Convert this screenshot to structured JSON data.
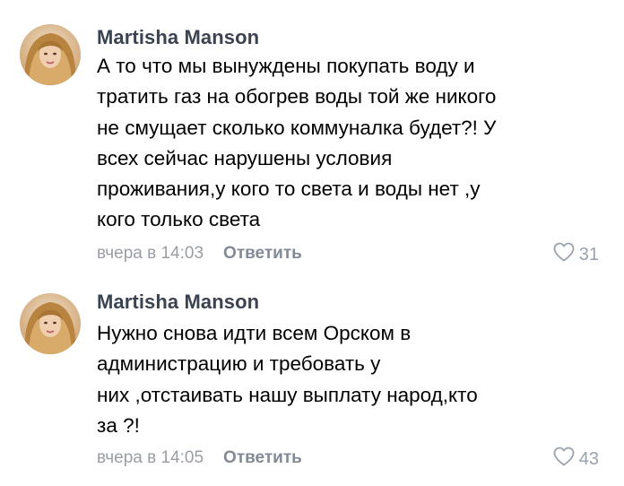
{
  "comments": [
    {
      "author": "Martisha Manson",
      "lines": [
        "А то что мы вынуждены покупать воду и",
        "тратить газ на обогрев воды той же никого",
        "не смущает сколько коммуналка будет?! У",
        "всех сейчас нарушены условия",
        "проживания,у кого то света и воды нет ,у",
        "кого только света"
      ],
      "time": "вчера в 14:03",
      "reply_label": "Ответить",
      "likes": "31"
    },
    {
      "author": "Martisha Manson",
      "lines": [
        "Нужно снова идти всем Орском в",
        "администрацию и требовать у",
        "них ,отстаивать нашу выплату народ,кто",
        "за ?!"
      ],
      "time": "вчера в 14:05",
      "reply_label": "Ответить",
      "likes": "43"
    }
  ],
  "colors": {
    "author": "#3b4351",
    "meta": "#9a9ea4",
    "reply": "#828a96",
    "like_icon": "#99a2ad"
  },
  "icons": {
    "like": "heart-outline-icon"
  }
}
